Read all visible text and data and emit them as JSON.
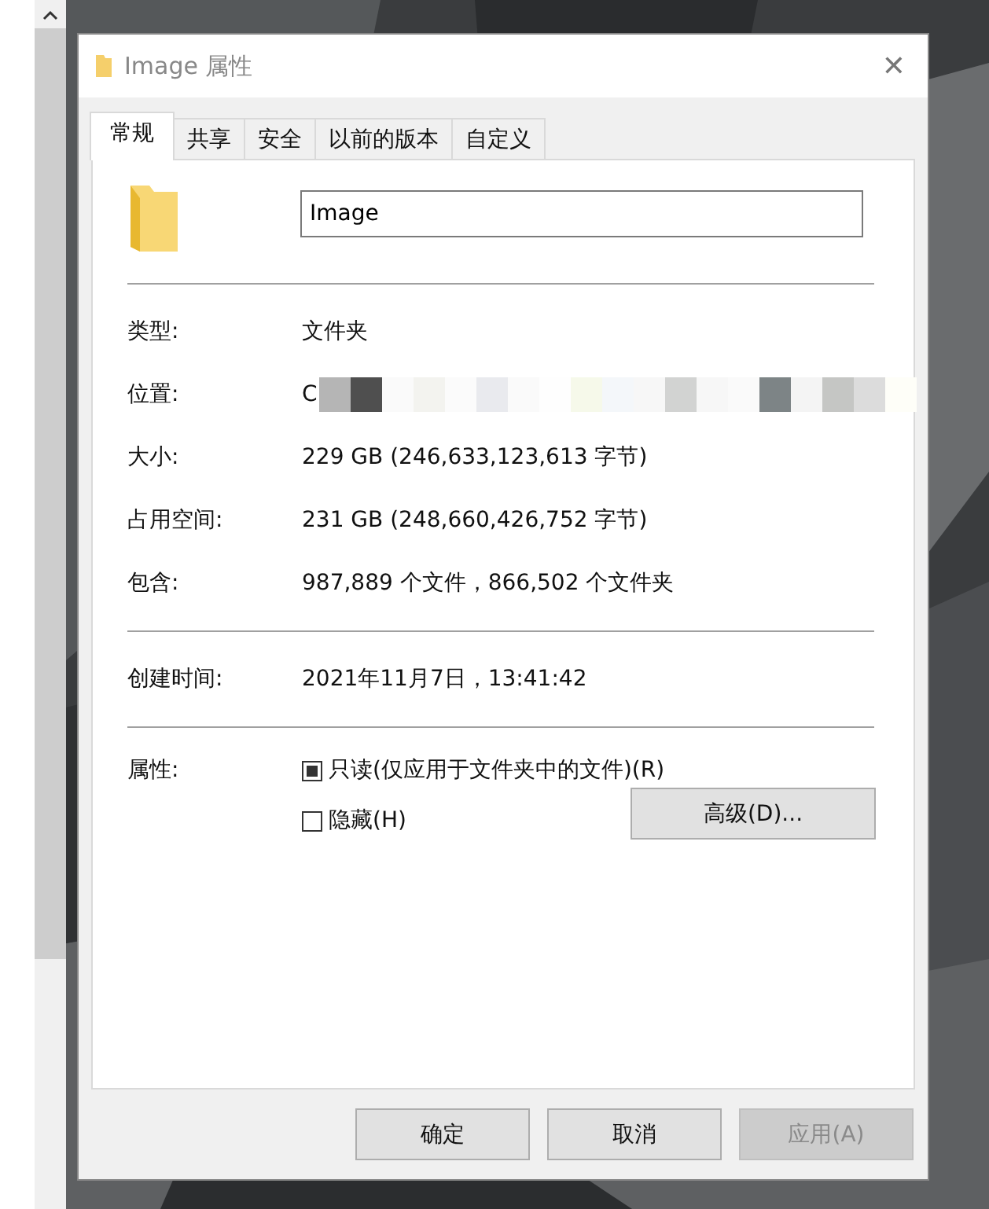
{
  "window": {
    "title": "Image 属性",
    "close": "✕"
  },
  "tabs": [
    {
      "label": "常规",
      "selected": true
    },
    {
      "label": "共享",
      "selected": false
    },
    {
      "label": "安全",
      "selected": false
    },
    {
      "label": "以前的版本",
      "selected": false
    },
    {
      "label": "自定义",
      "selected": false
    }
  ],
  "name_field": {
    "value": "Image"
  },
  "info_rows": [
    {
      "label": "类型:",
      "value": "文件夹",
      "redacted": false
    },
    {
      "label": "位置:",
      "value": "C",
      "redacted": true
    },
    {
      "label": "大小:",
      "value": "229 GB (246,633,123,613 字节)",
      "redacted": false
    },
    {
      "label": "占用空间:",
      "value": "231 GB (248,660,426,752 字节)",
      "redacted": false
    },
    {
      "label": "包含:",
      "value": "987,889 个文件，866,502 个文件夹",
      "redacted": false
    }
  ],
  "created": {
    "label": "创建时间:",
    "value": "2021年11月7日，13:41:42"
  },
  "attributes": {
    "label": "属性:",
    "checkboxes": [
      {
        "label": "只读(仅应用于文件夹中的文件)(R)",
        "checked": false,
        "indeterminate": true
      },
      {
        "label": "隐藏(H)",
        "checked": false,
        "indeterminate": false
      }
    ],
    "advanced_button": "高级(D)..."
  },
  "buttons": [
    {
      "label": "确定",
      "disabled": false
    },
    {
      "label": "取消",
      "disabled": false
    },
    {
      "label": "应用(A)",
      "disabled": true
    }
  ]
}
